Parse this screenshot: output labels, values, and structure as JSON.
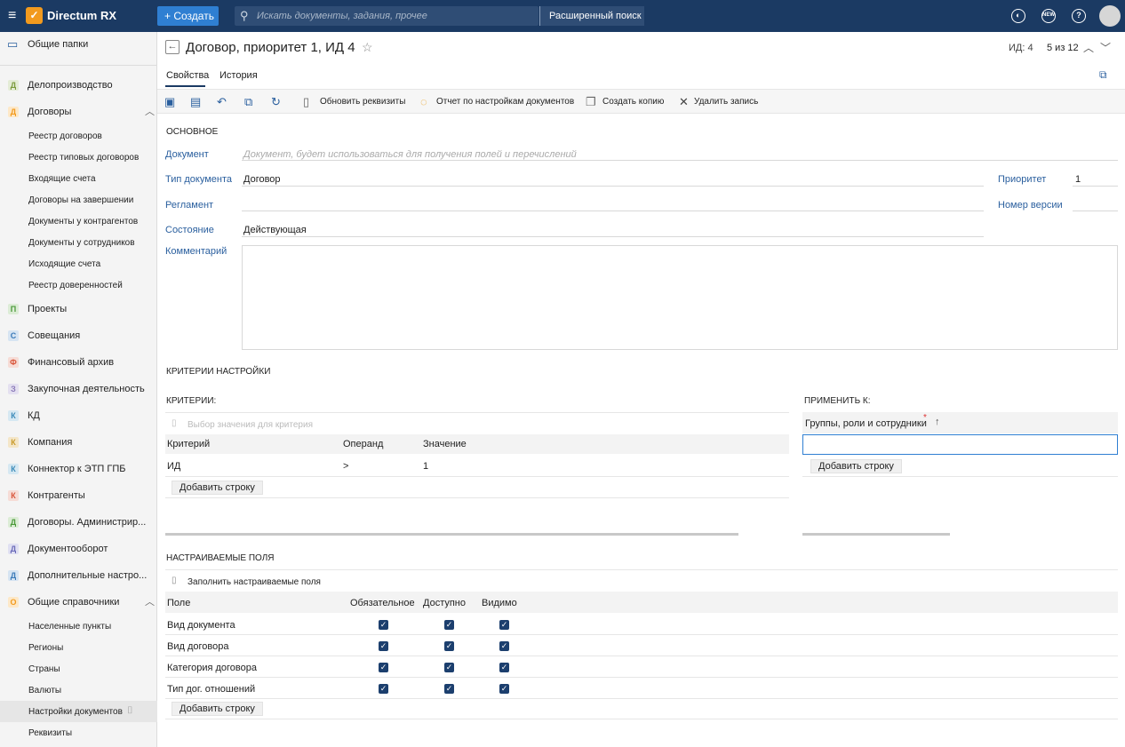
{
  "topbar": {
    "app_name": "Directum RX",
    "create_label": "+ Создать",
    "search_placeholder": "Искать документы, задания, прочее",
    "advanced_search": "Расширенный поиск",
    "new_badge": "NEW"
  },
  "sidebar": {
    "items": [
      {
        "badge": "Д",
        "label": "Делопроизводство",
        "color": "#7a9a3a"
      },
      {
        "badge": "Д",
        "label": "Договоры",
        "color": "#f29a1e"
      },
      {
        "badge": "П",
        "label": "Проекты",
        "color": "#4b9a3a"
      },
      {
        "badge": "С",
        "label": "Совещания",
        "color": "#3a7ab8"
      },
      {
        "badge": "Ф",
        "label": "Финансовый архив",
        "color": "#d8553a"
      },
      {
        "badge": "З",
        "label": "Закупочная деятельность",
        "color": "#8a7ab8"
      },
      {
        "badge": "К",
        "label": "КД",
        "color": "#3a8ab8"
      },
      {
        "badge": "К",
        "label": "Компания",
        "color": "#c89a2a"
      },
      {
        "badge": "К",
        "label": "Коннектор к ЭТП ГПБ",
        "color": "#3a8ab8"
      },
      {
        "badge": "К",
        "label": "Контрагенты",
        "color": "#d8553a"
      },
      {
        "badge": "Д",
        "label": "Договоры. Администрир...",
        "color": "#4b9a3a"
      },
      {
        "badge": "Д",
        "label": "Документооборот",
        "color": "#6a6ab8"
      },
      {
        "badge": "Д",
        "label": "Дополнительные настро...",
        "color": "#3a7ab8"
      },
      {
        "badge": "О",
        "label": "Общие справочники",
        "color": "#f29a1e"
      }
    ],
    "shared_folders": "Общие папки",
    "contracts_sub": [
      "Реестр договоров",
      "Реестр типовых договоров",
      "Входящие счета",
      "Договоры на завершении",
      "Документы у контрагентов",
      "Документы у сотрудников",
      "Исходящие счета",
      "Реестр доверенностей"
    ],
    "refs_sub": [
      "Населенные пункты",
      "Регионы",
      "Страны",
      "Валюты",
      "Настройки документов",
      "Реквизиты"
    ]
  },
  "header": {
    "title": "Договор, приоритет 1, ИД 4",
    "id_label": "ИД: 4",
    "counter": "5 из 12"
  },
  "tabs": {
    "properties": "Свойства",
    "history": "История"
  },
  "toolbar": {
    "refresh_requisites": "Обновить реквизиты",
    "report": "Отчет по настройкам документов",
    "copy": "Создать копию",
    "delete": "Удалить запись"
  },
  "form": {
    "section_main": "ОСНОВНОЕ",
    "document_label": "Документ",
    "document_placeholder": "Документ, будет использоваться для получения полей и перечислений",
    "doctype_label": "Тип документа",
    "doctype_value": "Договор",
    "reglament_label": "Регламент",
    "state_label": "Состояние",
    "state_value": "Действующая",
    "comment_label": "Комментарий",
    "priority_label": "Приоритет",
    "priority_value": "1",
    "version_label": "Номер версии"
  },
  "criteria": {
    "section_title": "КРИТЕРИИ НАСТРОЙКИ",
    "criteria_label": "КРИТЕРИИ:",
    "select_value": "Выбор значения для критерия",
    "columns": [
      "Критерий",
      "Операнд",
      "Значение"
    ],
    "rows": [
      [
        "ИД",
        ">",
        "1"
      ]
    ],
    "add_row": "Добавить строку",
    "apply_label": "ПРИМЕНИТЬ К:",
    "apply_column": "Группы, роли и сотрудники",
    "apply_add_row": "Добавить строку"
  },
  "custom_fields": {
    "section_title": "НАСТРАИВАЕМЫЕ ПОЛЯ",
    "fill_action": "Заполнить настраиваемые поля",
    "columns": [
      "Поле",
      "Обязательное",
      "Доступно",
      "Видимо"
    ],
    "rows": [
      {
        "field": "Вид документа",
        "required": true,
        "available": true,
        "visible": true
      },
      {
        "field": "Вид договора",
        "required": true,
        "available": true,
        "visible": true
      },
      {
        "field": "Категория договора",
        "required": true,
        "available": true,
        "visible": true
      },
      {
        "field": "Тип дог. отношений",
        "required": true,
        "available": true,
        "visible": true
      }
    ],
    "add_row": "Добавить строку"
  }
}
